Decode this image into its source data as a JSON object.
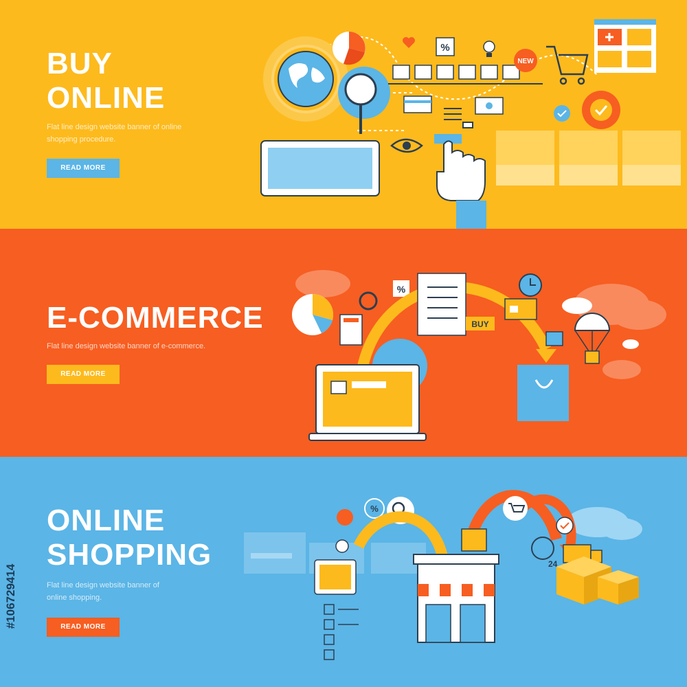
{
  "banners": [
    {
      "title_line1": "BUY",
      "title_line2": "ONLINE",
      "description_line1": "Flat line design website banner of online",
      "description_line2": "shopping procedure.",
      "button_label": "READ MORE",
      "background": "#fdba1d",
      "button_color": "#5bb5e6"
    },
    {
      "title_line1": "E-COMMERCE",
      "description_line1": "Flat line design website banner of e-commerce.",
      "button_label": "READ MORE",
      "background": "#f75e21",
      "button_color": "#fdba1d"
    },
    {
      "title_line1": "ONLINE",
      "title_line2": "SHOPPING",
      "description_line1": "Flat line design website banner of",
      "description_line2": "online shopping.",
      "button_label": "READ MORE",
      "background": "#5bb5e6",
      "button_color": "#f75e21"
    }
  ],
  "illustration_labels": {
    "new_badge": "NEW",
    "percent": "%",
    "buy_tag": "BUY",
    "clock_24": "24"
  },
  "stock_id": "#106729414",
  "icons": [
    "globe-icon",
    "gear-icon",
    "pie-chart-icon",
    "magnifier-icon",
    "gift-icon",
    "shopping-cart-icon",
    "keyboard-icon",
    "eye-icon",
    "hand-pointer-icon",
    "laptop-icon",
    "shopping-bag-icon",
    "parachute-icon",
    "clock-icon",
    "credit-card-icon",
    "cloud-icon",
    "store-icon",
    "truck-icon",
    "box-icon",
    "heart-icon",
    "lightbulb-icon"
  ]
}
